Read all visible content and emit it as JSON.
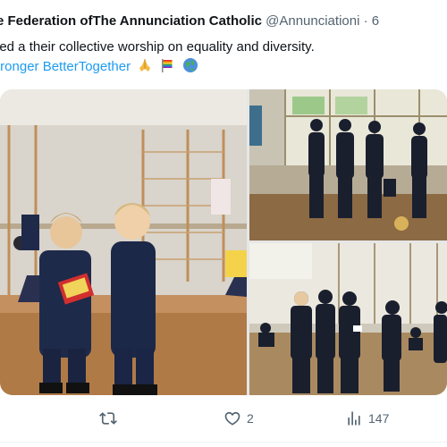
{
  "tweet": {
    "author_name": "e Federation ofThe Annunciation Catholic",
    "author_handle": "@Annunciationi · 6",
    "text_line": "led a their collective worship on equality and diversity.",
    "hashtag": "#StrongerBetterTogether",
    "hashtag_visible": "tronger BetterTogether",
    "emojis": [
      "folded-hands-emoji",
      "rainbow-flag-emoji",
      "globe-emoji"
    ]
  },
  "media": {
    "count": 3
  },
  "actions": {
    "retweet_count": "",
    "like_count": "2",
    "views_count": "147"
  },
  "colors": {
    "link": "#1d9bf0",
    "muted": "#536471",
    "text": "#0f1419"
  }
}
